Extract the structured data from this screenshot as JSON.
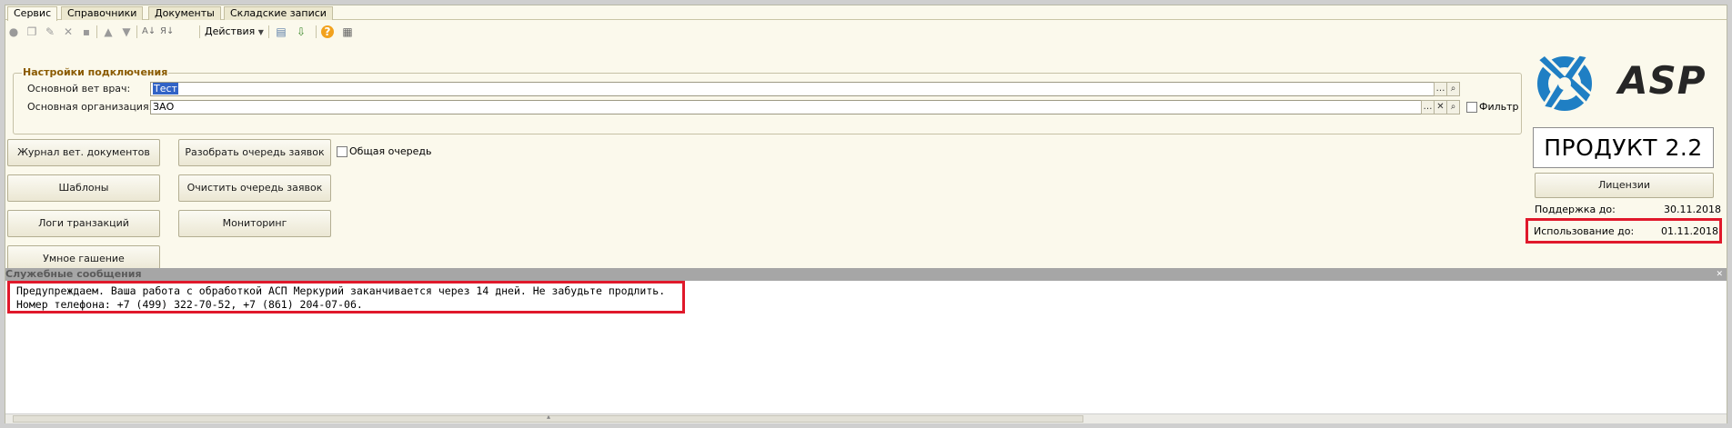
{
  "tabs": [
    {
      "label": "Сервис",
      "active": true
    },
    {
      "label": "Справочники",
      "active": false
    },
    {
      "label": "Документы",
      "active": false
    },
    {
      "label": "Складские записи",
      "active": false
    }
  ],
  "toolbar": {
    "actions_label": "Действия",
    "icons": [
      "add-circle-icon",
      "copy-icon",
      "edit-icon",
      "delete-icon",
      "save-icon",
      "move-up-icon",
      "move-down-icon",
      "sort-asc-icon",
      "sort-desc-icon",
      "actions-menu",
      "print-icon",
      "export-icon",
      "help-icon",
      "settings-icon"
    ]
  },
  "connection": {
    "group_title": "Настройки подключения",
    "vet_label": "Основной вет врач:",
    "vet_value": "Тест",
    "org_label": "Основная организация:",
    "org_value": "ЗАО",
    "filter_label": "Фильтр",
    "filter_checked": false
  },
  "buttons": {
    "journal": "Журнал вет. документов",
    "templates": "Шаблоны",
    "logs": "Логи транзакций",
    "smart": "Умное гашение",
    "parse_queue": "Разобрать очередь заявок",
    "clear_queue": "Очистить очередь заявок",
    "monitoring": "Мониторинг",
    "common_queue_label": "Общая очередь",
    "common_queue_checked": false
  },
  "product": {
    "logo_text": "ASP",
    "name": "ПРОДУКТ 2.2",
    "licenses_button": "Лицензии",
    "support_label": "Поддержка до:",
    "support_date": "30.11.2018",
    "usage_label": "Использование до:",
    "usage_date": "01.11.2018"
  },
  "messages": {
    "title": "Служебные сообщения",
    "lines": [
      "Предупреждаем. Ваша работа с обработкой АСП Меркурий заканчивается через 14 дней. Не забудьте продлить.",
      "Номер телефона: +7 (499) 322-70-52, +7 (861) 204-07-06."
    ]
  },
  "colors": {
    "background": "#fbf9ec",
    "highlight_red": "#e0192b",
    "logo_blue": "#1f7fc4",
    "selection_blue": "#3163c6"
  }
}
